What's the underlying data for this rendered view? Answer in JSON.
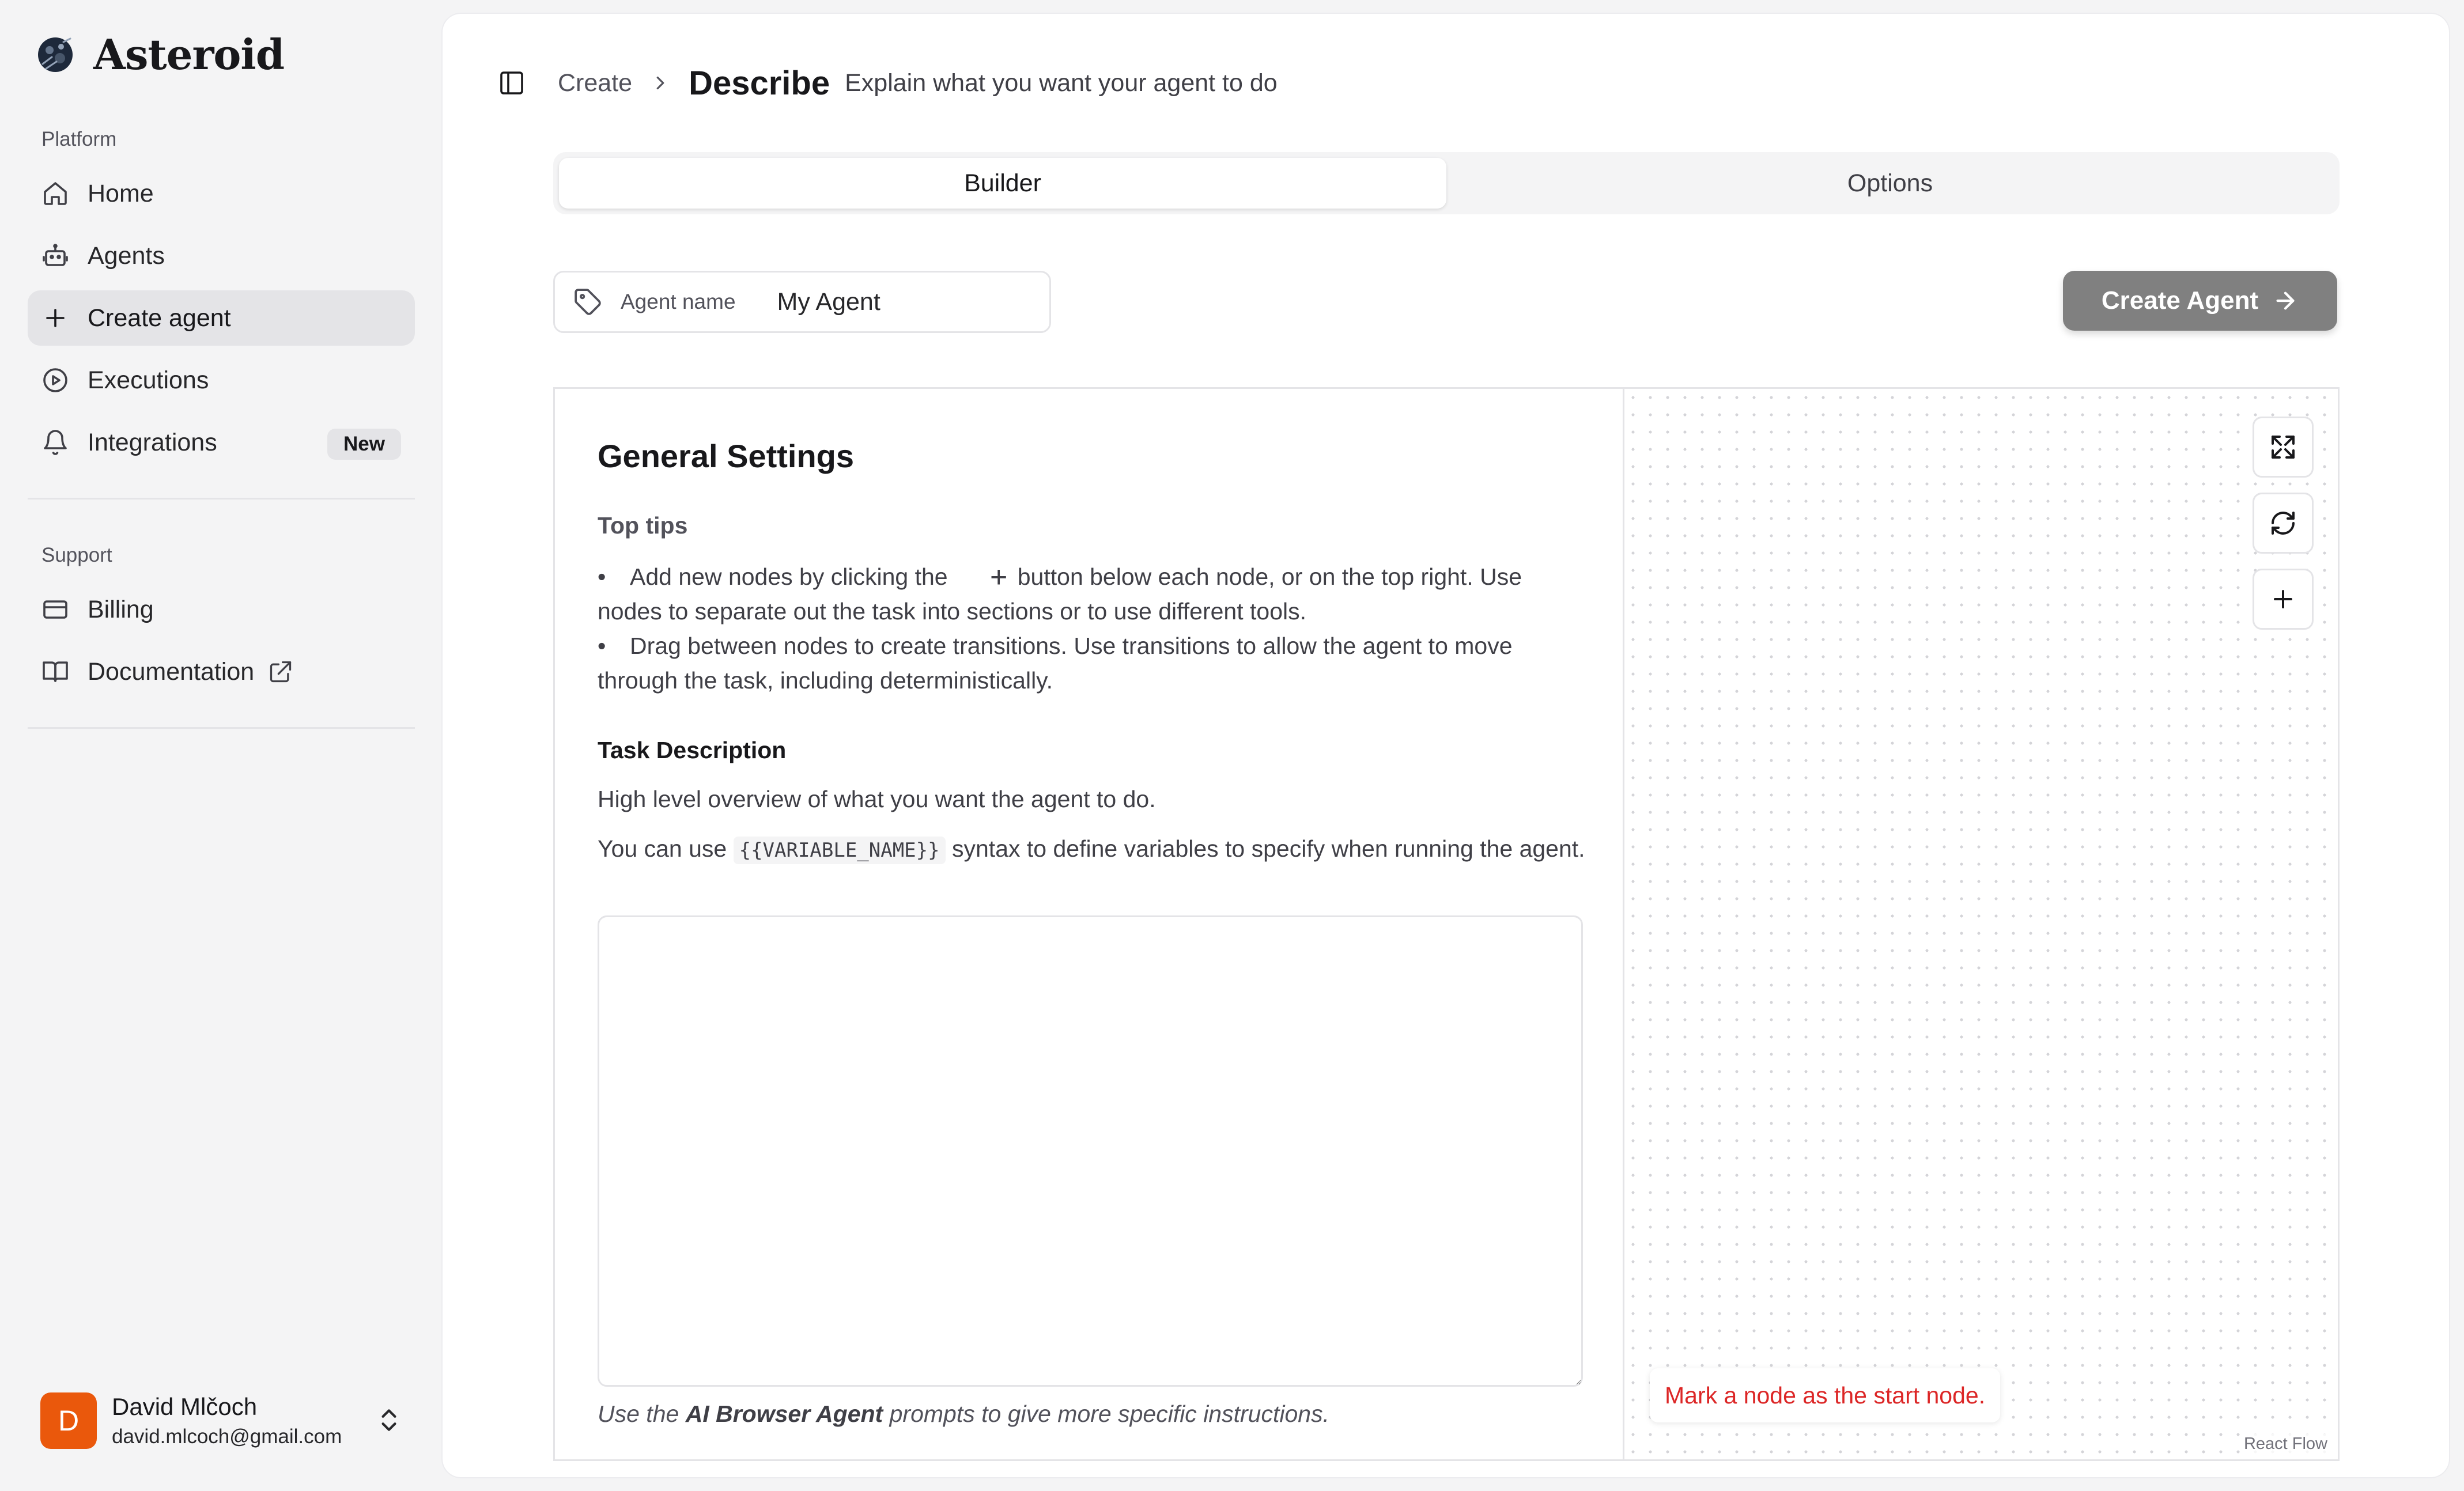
{
  "app": {
    "name": "Asteroid",
    "logo_icon": "asteroid-logo-icon"
  },
  "sidebar": {
    "platform_label": "Platform",
    "platform_items": [
      {
        "label": "Home",
        "icon": "home-icon",
        "active": false
      },
      {
        "label": "Agents",
        "icon": "bot-icon",
        "active": false
      },
      {
        "label": "Create agent",
        "icon": "plus-icon",
        "active": true
      },
      {
        "label": "Executions",
        "icon": "play-circle-icon",
        "active": false
      },
      {
        "label": "Integrations",
        "icon": "bell-icon",
        "active": false,
        "badge": "New"
      }
    ],
    "support_label": "Support",
    "support_items": [
      {
        "label": "Billing",
        "icon": "credit-card-icon"
      },
      {
        "label": "Documentation",
        "icon": "book-icon",
        "external_icon": "external-link-icon"
      }
    ],
    "user": {
      "initial": "D",
      "name": "David Mlčoch",
      "email": "david.mlcoch@gmail.com",
      "avatar_color": "#ea580c"
    }
  },
  "header": {
    "breadcrumb_parent": "Create",
    "breadcrumb_current": "Describe",
    "description": "Explain what you want your agent to do"
  },
  "tabs": [
    {
      "label": "Builder",
      "active": true
    },
    {
      "label": "Options",
      "active": false
    }
  ],
  "agent_name": {
    "label": "Agent name",
    "value": "My Agent",
    "placeholder": "My Agent"
  },
  "create_button": {
    "label": "Create Agent"
  },
  "settings": {
    "title": "General Settings",
    "tips_heading": "Top tips",
    "tip1_before": "Add new nodes by clicking the",
    "tip1_plus": "+",
    "tip1_after": "button below each node, or on the top right. Use nodes to separate out the task into sections or to use different tools.",
    "tip2": "Drag between nodes to create transitions. Use transitions to allow the agent to move through the task, including deterministically.",
    "task_heading": "Task Description",
    "task_overview": "High level overview of what you want the agent to do.",
    "vars_before": "You can use",
    "vars_code": "{{VARIABLE_NAME}}",
    "vars_after": "syntax to define variables to specify when running the agent.",
    "task_value": "",
    "hint_before": "Use the",
    "hint_bold": "AI Browser Agent",
    "hint_after": "prompts to give more specific instructions."
  },
  "canvas": {
    "controls": [
      "fit-view-icon",
      "refresh-icon",
      "add-node-icon"
    ],
    "warning": "Mark a node as the start node.",
    "attribution": "React Flow",
    "warning_color": "#dc2626"
  },
  "colors": {
    "create_button_bg": "#808080",
    "active_nav_bg": "#e4e4e7"
  }
}
